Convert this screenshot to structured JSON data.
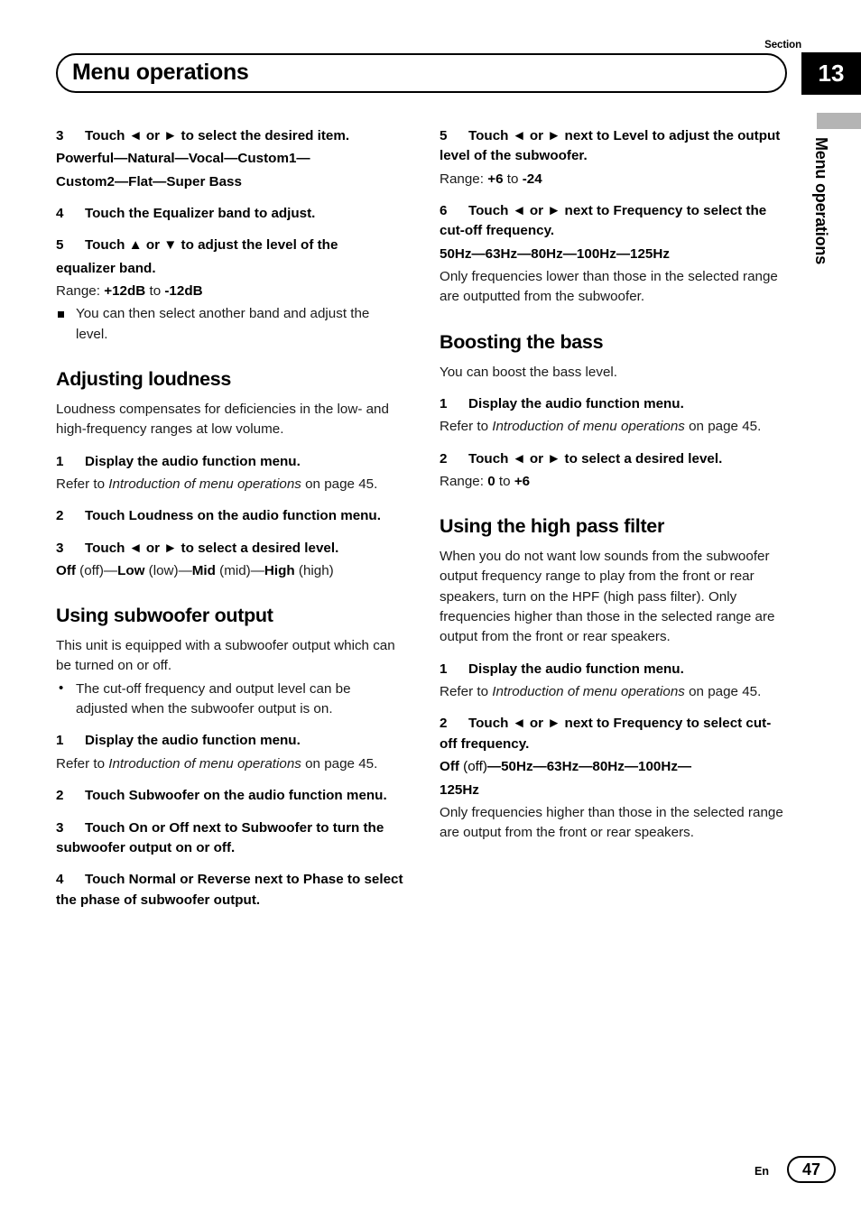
{
  "header": {
    "section_label": "Section",
    "chapter_number": "13",
    "title": "Menu operations"
  },
  "side_tab": {
    "label": "Menu operations"
  },
  "footer": {
    "language": "En",
    "page_number": "47"
  },
  "left_column": {
    "step3_eq": {
      "num": "3",
      "text": "Touch ◄ or ► to select the desired item.",
      "line2": "Powerful—Natural—Vocal—Custom1—",
      "line3": "Custom2—Flat—Super Bass"
    },
    "step4_eq": {
      "num": "4",
      "text": "Touch the Equalizer band to adjust."
    },
    "step5_eq": {
      "num": "5",
      "text": "Touch ▲ or ▼ to adjust the level of the",
      "line2": "equalizer band.",
      "range_label": "Range:",
      "range_from": "+12dB",
      "range_to_word": "to",
      "range_value": "-12dB",
      "note": "You can then select another band and adjust the level."
    },
    "loudness": {
      "heading": "Adjusting loudness",
      "intro": "Loudness compensates for deficiencies in the low- and high-frequency ranges at low volume.",
      "step1": {
        "num": "1",
        "text": "Display the audio function menu.",
        "refer_prefix": "Refer to",
        "refer_italic": "Introduction of menu operations",
        "refer_suffix": "on page 45."
      },
      "step2": {
        "num": "2",
        "text": "Touch Loudness on the audio function menu."
      },
      "step3": {
        "num": "3",
        "text": "Touch ◄ or ► to select a desired level.",
        "options": "Off (off)—Low (low)—Mid (mid)—High (high)"
      }
    },
    "subwoofer": {
      "heading": "Using subwoofer output",
      "intro": "This unit is equipped with a subwoofer output which can be turned on or off.",
      "bullet": "The cut-off frequency and output level can be adjusted when the subwoofer output is on.",
      "step1": {
        "num": "1",
        "text": "Display the audio function menu.",
        "refer_prefix": "Refer to",
        "refer_italic": "Introduction of menu operations",
        "refer_suffix": "on page 45."
      },
      "step2": {
        "num": "2",
        "text": "Touch Subwoofer on the audio function menu."
      },
      "step3": {
        "num": "3",
        "text": "Touch On or Off next to Subwoofer to turn the subwoofer output on or off."
      },
      "step4": {
        "num": "4",
        "text": "Touch Normal or Reverse next to Phase to select the phase of subwoofer output."
      }
    }
  },
  "right_column": {
    "step5_sub": {
      "num": "5",
      "text": "Touch ◄ or ► next to Level to adjust the output level of the subwoofer.",
      "range_label": "Range:",
      "range_from": "+6",
      "range_to_word": "to",
      "range_value": "-24"
    },
    "step6_sub": {
      "num": "6",
      "text": "Touch ◄ or ► next to Frequency to select the cut-off frequency.",
      "options": "50Hz—63Hz—80Hz—100Hz—125Hz",
      "note": "Only frequencies lower than those in the selected range are outputted from the subwoofer."
    },
    "bass": {
      "heading": "Boosting the bass",
      "intro": "You can boost the bass level.",
      "step1": {
        "num": "1",
        "text": "Display the audio function menu.",
        "refer_prefix": "Refer to",
        "refer_italic": "Introduction of menu operations",
        "refer_suffix": "on page 45."
      },
      "step2": {
        "num": "2",
        "text": "Touch ◄ or ► to select a desired level.",
        "range_label": "Range:",
        "range_from": "0",
        "range_to_word": "to",
        "range_value": "+6"
      }
    },
    "hpf": {
      "heading": "Using the high pass filter",
      "intro": "When you do not want low sounds from the subwoofer output frequency range to play from the front or rear speakers, turn on the HPF (high pass filter). Only frequencies higher than those in the selected range are output from the front or rear speakers.",
      "step1": {
        "num": "1",
        "text": "Display the audio function menu.",
        "refer_prefix": "Refer to",
        "refer_italic": "Introduction of menu operations",
        "refer_suffix": "on page 45."
      },
      "step2": {
        "num": "2",
        "text": "Touch ◄ or ► next to Frequency to select cut-off frequency.",
        "options_line1": "Off (off)—50Hz—63Hz—80Hz—100Hz—",
        "options_line2": "125Hz",
        "note": "Only frequencies higher than those in the selected range are output from the front or rear speakers."
      }
    }
  }
}
